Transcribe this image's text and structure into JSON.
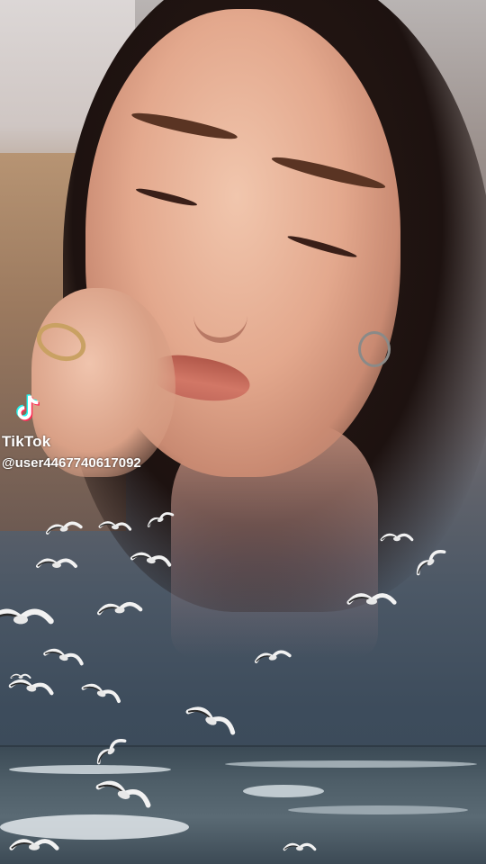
{
  "watermark": {
    "brand": "TikTok",
    "username": "@user4467740617092",
    "logo_icon": "tiktok-note-icon"
  },
  "colors": {
    "logo_cyan": "#25f4ee",
    "logo_red": "#fe2c55",
    "logo_white": "#ffffff"
  }
}
